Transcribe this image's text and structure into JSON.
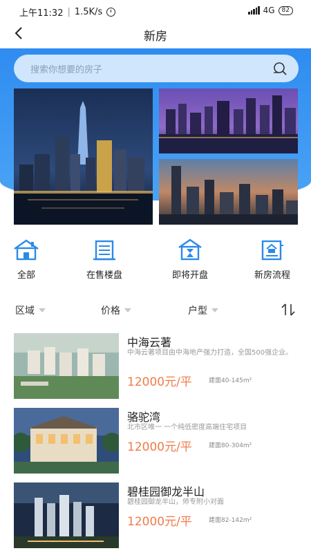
{
  "status_bar": {
    "time": "上午11:32",
    "speed": "1.5K/s",
    "network": "4G",
    "battery": "82"
  },
  "header": {
    "title": "新房"
  },
  "search": {
    "placeholder": "搜索你想要的房子"
  },
  "categories": [
    {
      "label": "全部",
      "icon": "home-icon"
    },
    {
      "label": "在售楼盘",
      "icon": "building-icon"
    },
    {
      "label": "即将开盘",
      "icon": "hourglass-house-icon"
    },
    {
      "label": "新房流程",
      "icon": "document-house-icon"
    }
  ],
  "filters": [
    {
      "label": "区域"
    },
    {
      "label": "价格"
    },
    {
      "label": "户型"
    }
  ],
  "listings": [
    {
      "name": "中海云著",
      "desc": "中海云著项目由中海地产强力打造，全国500强企业。",
      "price": "12000元/平",
      "area": "建面40-145m²"
    },
    {
      "name": "骆驼湾",
      "desc": "北市区唯一 一个纯低密度高端住宅项目",
      "price": "12000元/平",
      "area": "建面80-304m²"
    },
    {
      "name": "碧桂园御龙半山",
      "desc": "碧桂园御龙半山，师专附小对面",
      "price": "12000元/平",
      "area": "建面82-142m²"
    }
  ],
  "colors": {
    "primary_blue": "#2f8cf0",
    "search_bg": "#cfe6fd",
    "price_orange": "#f07a4a",
    "icon_blue": "#2a8ae8"
  }
}
